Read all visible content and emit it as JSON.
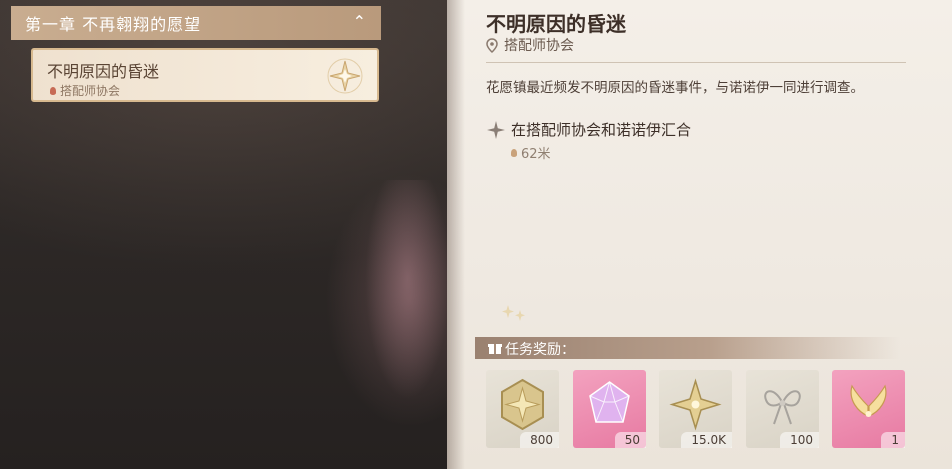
{
  "quest_list": {
    "chapter_title": "第一章 不再翱翔的愿望",
    "selected_quest": {
      "title": "不明原因的昏迷",
      "location": "搭配师协会"
    }
  },
  "detail": {
    "title": "不明原因的昏迷",
    "location": "搭配师协会",
    "description": "花愿镇最近频发不明原因的昏迷事件，与诺诺伊一同进行调查。",
    "objective": {
      "text": "在搭配师协会和诺诺伊汇合",
      "distance": "62米"
    }
  },
  "rewards": {
    "label": "任务奖励：",
    "items": [
      {
        "icon": "gold-star-coin-icon",
        "count": "800"
      },
      {
        "icon": "pink-crystal-icon",
        "count": "50"
      },
      {
        "icon": "gold-star-shard-icon",
        "count": "15.0K"
      },
      {
        "icon": "silver-bow-icon",
        "count": "100"
      },
      {
        "icon": "golden-wings-icon",
        "count": "1"
      }
    ]
  },
  "colors": {
    "chapter_header": "#c9ad90",
    "panel": "#f2ece4",
    "pink_rarity": "#ec8fb0",
    "accent_pin": "#c76b55"
  }
}
